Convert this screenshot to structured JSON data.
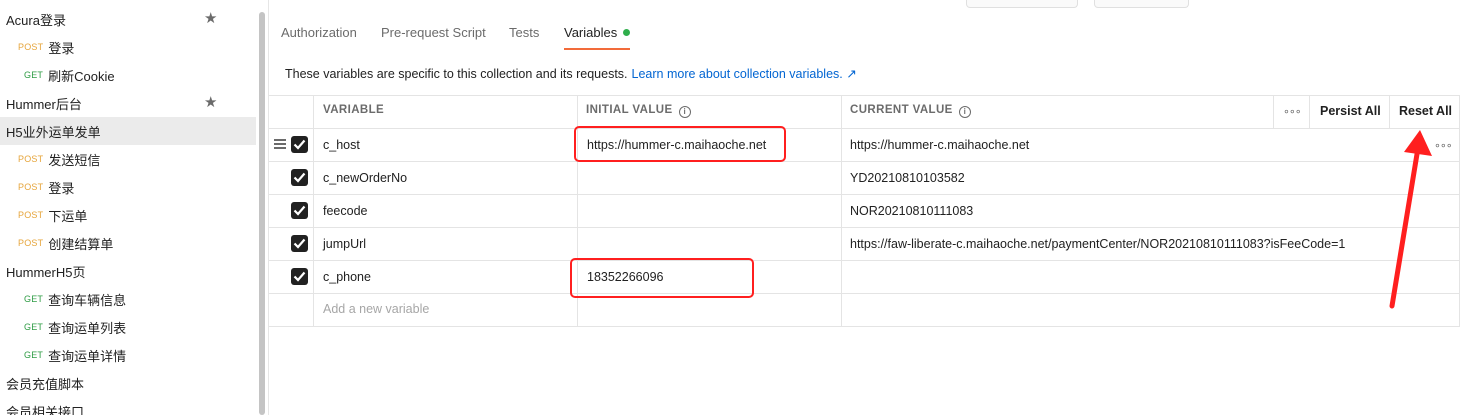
{
  "sidebar": {
    "items": [
      {
        "label": "Acura登录",
        "type": "folder",
        "starred": true
      },
      {
        "label": "登录",
        "type": "request",
        "method": "POST"
      },
      {
        "label": "刷新Cookie",
        "type": "request",
        "method": "GET"
      },
      {
        "label": "Hummer后台",
        "type": "folder",
        "starred": true
      },
      {
        "label": "H5业外运单发单",
        "type": "folder",
        "selected": true
      },
      {
        "label": "发送短信",
        "type": "request",
        "method": "POST"
      },
      {
        "label": "登录",
        "type": "request",
        "method": "POST"
      },
      {
        "label": "下运单",
        "type": "request",
        "method": "POST"
      },
      {
        "label": "创建结算单",
        "type": "request",
        "method": "POST"
      },
      {
        "label": "HummerH5页",
        "type": "folder"
      },
      {
        "label": "查询车辆信息",
        "type": "request",
        "method": "GET"
      },
      {
        "label": "查询运单列表",
        "type": "request",
        "method": "GET"
      },
      {
        "label": "查询运单详情",
        "type": "request",
        "method": "GET"
      },
      {
        "label": "会员充值脚本",
        "type": "folder"
      },
      {
        "label": "会员相关接口",
        "type": "folder"
      }
    ]
  },
  "tabs": [
    {
      "label": "Authorization"
    },
    {
      "label": "Pre-request Script"
    },
    {
      "label": "Tests"
    },
    {
      "label": "Variables",
      "active": true,
      "indicator": "green-dot"
    }
  ],
  "info": {
    "text": "These variables are specific to this collection and its requests.",
    "link": "Learn more about collection variables. ↗"
  },
  "table": {
    "headers": {
      "variable": "VARIABLE",
      "initial": "INITIAL VALUE",
      "current": "CURRENT VALUE",
      "more": "∘∘∘",
      "persist_all": "Persist All",
      "reset_all": "Reset All"
    },
    "rows": [
      {
        "checked": true,
        "variable": "c_host",
        "initial": "https://hummer-c.maihaoche.net",
        "current": "https://hummer-c.maihaoche.net"
      },
      {
        "checked": true,
        "variable": "c_newOrderNo",
        "initial": "",
        "current": "YD20210810103582"
      },
      {
        "checked": true,
        "variable": "feecode",
        "initial": "",
        "current": "NOR20210810111083"
      },
      {
        "checked": true,
        "variable": "jumpUrl",
        "initial": "",
        "current": "https://faw-liberate-c.maihaoche.net/paymentCenter/NOR20210810111083?isFeeCode=1"
      },
      {
        "checked": true,
        "variable": "c_phone",
        "initial": "18352266096",
        "current": ""
      }
    ],
    "add_placeholder": "Add a new variable",
    "row_more": "∘∘∘"
  },
  "colors": {
    "accent": "#f26b3a",
    "link": "#0265d2",
    "post": "#e6a53b",
    "get": "#2f9c45",
    "annotation": "#ff1f1f"
  }
}
